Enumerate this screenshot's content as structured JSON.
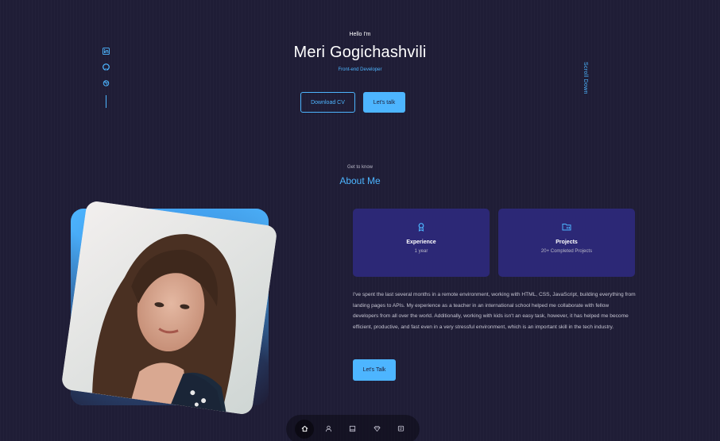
{
  "hero": {
    "greeting": "Hello I'm",
    "name": "Meri Gogichashvili",
    "role": "Front-end Developer",
    "download_cv_label": "Download CV",
    "lets_talk_label": "Let's talk"
  },
  "socials": [
    {
      "icon": "linkedin-icon"
    },
    {
      "icon": "github-icon"
    },
    {
      "icon": "dribbble-icon"
    }
  ],
  "scroll_down_label": "Scroll Down",
  "about": {
    "subtitle": "Get to know",
    "title": "About Me",
    "cards": [
      {
        "icon": "award-icon",
        "title": "Experience",
        "subtitle": "1 year"
      },
      {
        "icon": "folder-icon",
        "title": "Projects",
        "subtitle": "20+ Completed Projects"
      }
    ],
    "bio": "I've spent the last several months in a remote environment, working with HTML, CSS, JavaScript, building everything from landing pages to APIs. My experience as a teacher in an international school helped me collaborate with fellow developers from all over the world. Additionally, working with kids isn't an easy task, however, it has helped me become efficient, productive, and fast even in a very stressful environment, which is an important skill in the tech industry.",
    "cta_label": "Let's Talk"
  },
  "nav": [
    {
      "icon": "home-icon",
      "active": true
    },
    {
      "icon": "user-icon",
      "active": false
    },
    {
      "icon": "book-icon",
      "active": false
    },
    {
      "icon": "services-icon",
      "active": false
    },
    {
      "icon": "message-icon",
      "active": false
    }
  ],
  "colors": {
    "background": "#1f1d36",
    "accent": "#4db5ff",
    "card": "#2c2876"
  }
}
